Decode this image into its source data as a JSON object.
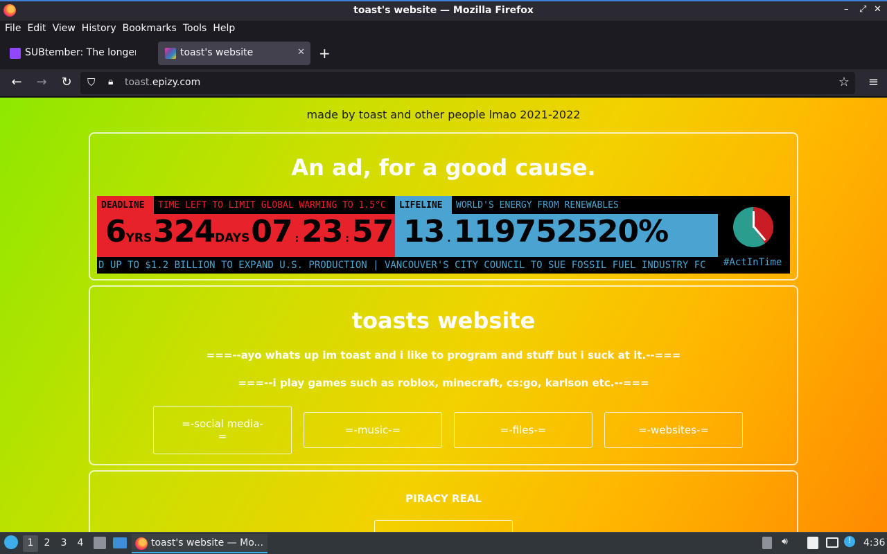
{
  "window": {
    "title": "toast's website — Mozilla Firefox",
    "controls": [
      "–",
      "⤢",
      "✕"
    ]
  },
  "menu": {
    "file": "File",
    "edit": "Edit",
    "view": "View",
    "history": "History",
    "bookmarks": "Bookmarks",
    "tools": "Tools",
    "help": "Help"
  },
  "tabs": [
    {
      "label": "SUBtember: The longer t",
      "favicon_color": "#9146ff",
      "active": false
    },
    {
      "label": "toast's website",
      "favicon_color": "#ff3cac",
      "active": true
    }
  ],
  "navbar": {
    "url_host_dim": "toast.",
    "url_host": "epizy.com"
  },
  "page": {
    "made_by": "made by toast and other people lmao 2021-2022",
    "ad_title": "An ad, for a good cause.",
    "clock": {
      "deadline_label": "DEADLINE",
      "deadline_text": "TIME LEFT TO LIMIT GLOBAL WARMING TO 1.5°C",
      "years": "6",
      "years_unit": "YRS",
      "days": "324",
      "days_unit": "DAYS",
      "hours": "07",
      "minutes": "23",
      "seconds": "57",
      "lifeline_label": "LIFELINE",
      "lifeline_text": "WORLD'S ENERGY FROM RENEWABLES",
      "lifeline_int": "13",
      "lifeline_frac": "119752520%",
      "ticker": "D UP TO $1.2 BILLION TO EXPAND U.S. PRODUCTION | VANCOUVER'S CITY COUNCIL TO SUE FOSSIL FUEL INDUSTRY FC",
      "hashtag": "#ActInTime"
    },
    "site_title": "toasts website",
    "intro1": "===--ayo whats up im toast and i like to program and stuff but i suck at it.--===",
    "intro2": "===--i play games such as roblox, minecraft, cs:go, karlson etc.--===",
    "buttons": {
      "social": "=-social media-=",
      "music": "=-music-=",
      "files": "=-files-=",
      "websites": "=-websites-="
    },
    "piracy_title": "PIRACY REAL"
  },
  "taskbar": {
    "desktops": [
      "1",
      "2",
      "3",
      "4"
    ],
    "task_label": "toast's website — Mo...",
    "clock": "4:36"
  }
}
